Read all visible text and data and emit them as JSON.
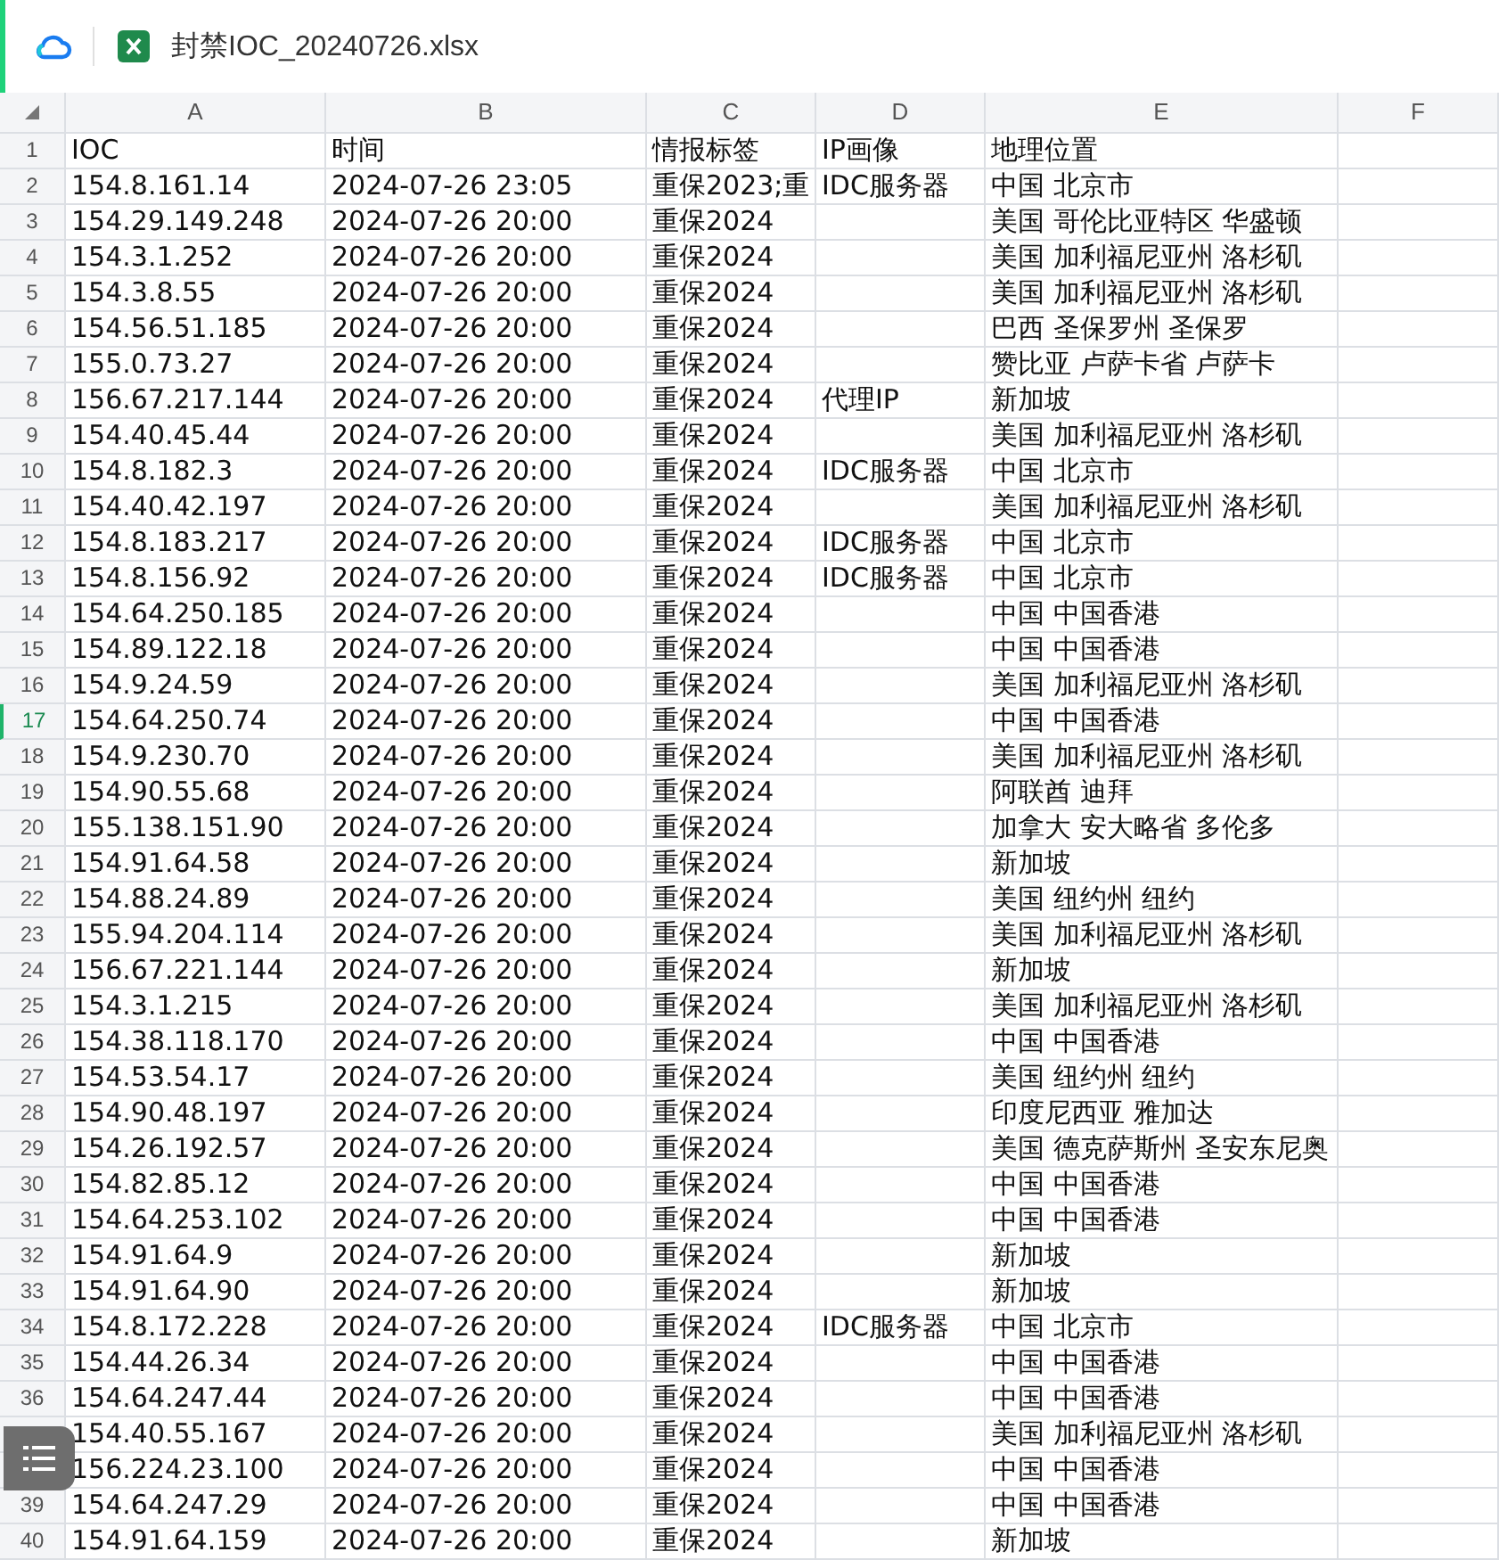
{
  "file": {
    "title": "封禁IOC_20240726.xlsx"
  },
  "sheet": {
    "columns": [
      "A",
      "B",
      "C",
      "D",
      "E",
      "F"
    ],
    "rows": [
      {
        "n": "1",
        "selected": false,
        "cells": [
          "IOC",
          "时间",
          "情报标签",
          "IP画像",
          "地理位置",
          ""
        ]
      },
      {
        "n": "2",
        "selected": false,
        "cells": [
          "154.8.161.14",
          "2024-07-26 23:05",
          "重保2023;重",
          "IDC服务器",
          "中国 北京市",
          ""
        ]
      },
      {
        "n": "3",
        "selected": false,
        "cells": [
          "154.29.149.248",
          "2024-07-26 20:00",
          "重保2024",
          "",
          "美国 哥伦比亚特区 华盛顿",
          ""
        ]
      },
      {
        "n": "4",
        "selected": false,
        "cells": [
          "154.3.1.252",
          "2024-07-26 20:00",
          "重保2024",
          "",
          "美国 加利福尼亚州 洛杉矶",
          ""
        ]
      },
      {
        "n": "5",
        "selected": false,
        "cells": [
          "154.3.8.55",
          "2024-07-26 20:00",
          "重保2024",
          "",
          "美国 加利福尼亚州 洛杉矶",
          ""
        ]
      },
      {
        "n": "6",
        "selected": false,
        "cells": [
          "154.56.51.185",
          "2024-07-26 20:00",
          "重保2024",
          "",
          "巴西 圣保罗州 圣保罗",
          ""
        ]
      },
      {
        "n": "7",
        "selected": false,
        "cells": [
          "155.0.73.27",
          "2024-07-26 20:00",
          "重保2024",
          "",
          "赞比亚 卢萨卡省 卢萨卡",
          ""
        ]
      },
      {
        "n": "8",
        "selected": false,
        "cells": [
          "156.67.217.144",
          "2024-07-26 20:00",
          "重保2024",
          "代理IP",
          "新加坡",
          ""
        ]
      },
      {
        "n": "9",
        "selected": false,
        "cells": [
          "154.40.45.44",
          "2024-07-26 20:00",
          "重保2024",
          "",
          "美国 加利福尼亚州 洛杉矶",
          ""
        ]
      },
      {
        "n": "10",
        "selected": false,
        "cells": [
          "154.8.182.3",
          "2024-07-26 20:00",
          "重保2024",
          "IDC服务器",
          "中国 北京市",
          ""
        ]
      },
      {
        "n": "11",
        "selected": false,
        "cells": [
          "154.40.42.197",
          "2024-07-26 20:00",
          "重保2024",
          "",
          "美国 加利福尼亚州 洛杉矶",
          ""
        ]
      },
      {
        "n": "12",
        "selected": false,
        "cells": [
          "154.8.183.217",
          "2024-07-26 20:00",
          "重保2024",
          "IDC服务器",
          "中国 北京市",
          ""
        ]
      },
      {
        "n": "13",
        "selected": false,
        "cells": [
          "154.8.156.92",
          "2024-07-26 20:00",
          "重保2024",
          "IDC服务器",
          "中国 北京市",
          ""
        ]
      },
      {
        "n": "14",
        "selected": false,
        "cells": [
          "154.64.250.185",
          "2024-07-26 20:00",
          "重保2024",
          "",
          "中国 中国香港",
          ""
        ]
      },
      {
        "n": "15",
        "selected": false,
        "cells": [
          "154.89.122.18",
          "2024-07-26 20:00",
          "重保2024",
          "",
          "中国 中国香港",
          ""
        ]
      },
      {
        "n": "16",
        "selected": false,
        "cells": [
          "154.9.24.59",
          "2024-07-26 20:00",
          "重保2024",
          "",
          "美国 加利福尼亚州 洛杉矶",
          ""
        ]
      },
      {
        "n": "17",
        "selected": true,
        "cells": [
          "154.64.250.74",
          "2024-07-26 20:00",
          "重保2024",
          "",
          "中国 中国香港",
          ""
        ]
      },
      {
        "n": "18",
        "selected": false,
        "cells": [
          "154.9.230.70",
          "2024-07-26 20:00",
          "重保2024",
          "",
          "美国 加利福尼亚州 洛杉矶",
          ""
        ]
      },
      {
        "n": "19",
        "selected": false,
        "cells": [
          "154.90.55.68",
          "2024-07-26 20:00",
          "重保2024",
          "",
          "阿联酋 迪拜",
          ""
        ]
      },
      {
        "n": "20",
        "selected": false,
        "cells": [
          "155.138.151.90",
          "2024-07-26 20:00",
          "重保2024",
          "",
          "加拿大 安大略省 多伦多",
          ""
        ]
      },
      {
        "n": "21",
        "selected": false,
        "cells": [
          "154.91.64.58",
          "2024-07-26 20:00",
          "重保2024",
          "",
          "新加坡",
          ""
        ]
      },
      {
        "n": "22",
        "selected": false,
        "cells": [
          "154.88.24.89",
          "2024-07-26 20:00",
          "重保2024",
          "",
          "美国 纽约州 纽约",
          ""
        ]
      },
      {
        "n": "23",
        "selected": false,
        "cells": [
          "155.94.204.114",
          "2024-07-26 20:00",
          "重保2024",
          "",
          "美国 加利福尼亚州 洛杉矶",
          ""
        ]
      },
      {
        "n": "24",
        "selected": false,
        "cells": [
          "156.67.221.144",
          "2024-07-26 20:00",
          "重保2024",
          "",
          "新加坡",
          ""
        ]
      },
      {
        "n": "25",
        "selected": false,
        "cells": [
          "154.3.1.215",
          "2024-07-26 20:00",
          "重保2024",
          "",
          "美国 加利福尼亚州 洛杉矶",
          ""
        ]
      },
      {
        "n": "26",
        "selected": false,
        "cells": [
          "154.38.118.170",
          "2024-07-26 20:00",
          "重保2024",
          "",
          "中国 中国香港",
          ""
        ]
      },
      {
        "n": "27",
        "selected": false,
        "cells": [
          "154.53.54.17",
          "2024-07-26 20:00",
          "重保2024",
          "",
          "美国 纽约州 纽约",
          ""
        ]
      },
      {
        "n": "28",
        "selected": false,
        "cells": [
          "154.90.48.197",
          "2024-07-26 20:00",
          "重保2024",
          "",
          "印度尼西亚 雅加达",
          ""
        ]
      },
      {
        "n": "29",
        "selected": false,
        "cells": [
          "154.26.192.57",
          "2024-07-26 20:00",
          "重保2024",
          "",
          "美国 德克萨斯州 圣安东尼奥",
          ""
        ]
      },
      {
        "n": "30",
        "selected": false,
        "cells": [
          "154.82.85.12",
          "2024-07-26 20:00",
          "重保2024",
          "",
          "中国 中国香港",
          ""
        ]
      },
      {
        "n": "31",
        "selected": false,
        "cells": [
          "154.64.253.102",
          "2024-07-26 20:00",
          "重保2024",
          "",
          "中国 中国香港",
          ""
        ]
      },
      {
        "n": "32",
        "selected": false,
        "cells": [
          "154.91.64.9",
          "2024-07-26 20:00",
          "重保2024",
          "",
          "新加坡",
          ""
        ]
      },
      {
        "n": "33",
        "selected": false,
        "cells": [
          "154.91.64.90",
          "2024-07-26 20:00",
          "重保2024",
          "",
          "新加坡",
          ""
        ]
      },
      {
        "n": "34",
        "selected": false,
        "cells": [
          "154.8.172.228",
          "2024-07-26 20:00",
          "重保2024",
          "IDC服务器",
          "中国 北京市",
          ""
        ]
      },
      {
        "n": "35",
        "selected": false,
        "cells": [
          "154.44.26.34",
          "2024-07-26 20:00",
          "重保2024",
          "",
          "中国 中国香港",
          ""
        ]
      },
      {
        "n": "36",
        "selected": false,
        "cells": [
          "154.64.247.44",
          "2024-07-26 20:00",
          "重保2024",
          "",
          "中国 中国香港",
          ""
        ]
      },
      {
        "selected": false,
        "cells": [
          "154.40.55.167",
          "2024-07-26 20:00",
          "重保2024",
          "",
          "美国 加利福尼亚州 洛杉矶",
          ""
        ]
      },
      {
        "selected": false,
        "cells": [
          "156.224.23.100",
          "2024-07-26 20:00",
          "重保2024",
          "",
          "中国 中国香港",
          ""
        ]
      },
      {
        "n": "39",
        "selected": false,
        "cells": [
          "154.64.247.29",
          "2024-07-26 20:00",
          "重保2024",
          "",
          "中国 中国香港",
          ""
        ]
      },
      {
        "n": "40",
        "selected": false,
        "cells": [
          "154.91.64.159",
          "2024-07-26 20:00",
          "重保2024",
          "",
          "新加坡",
          ""
        ]
      }
    ]
  }
}
